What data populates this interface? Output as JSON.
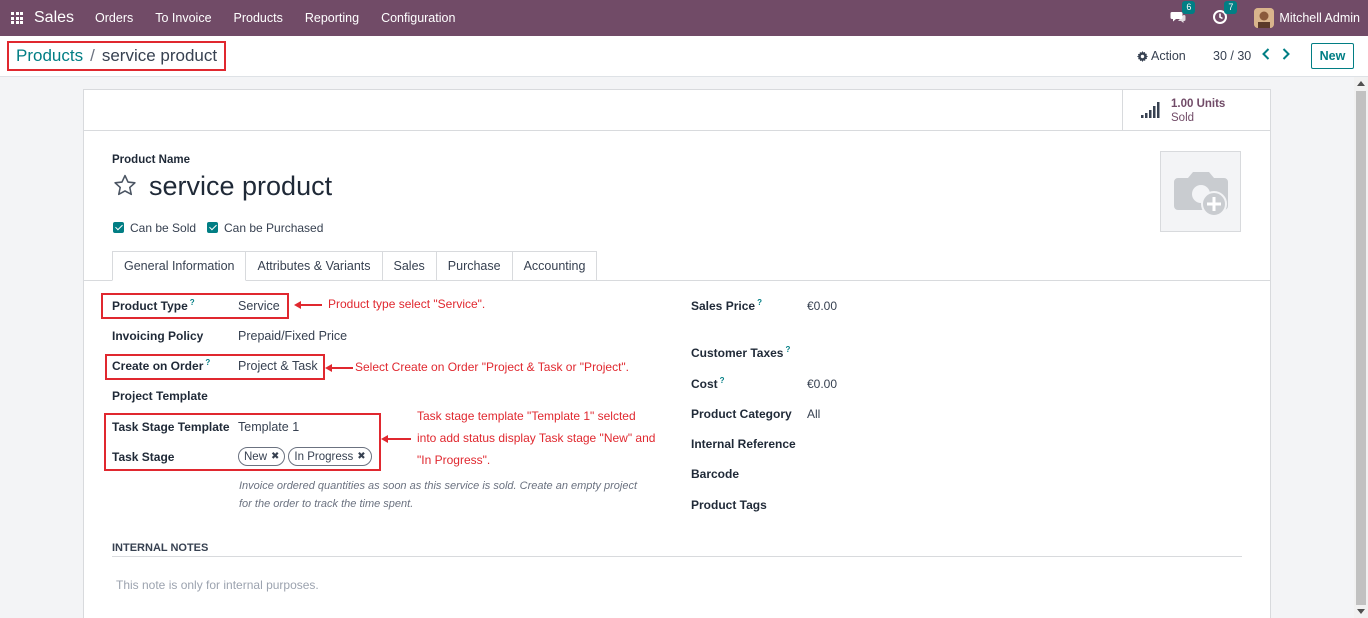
{
  "navbar": {
    "app_name": "Sales",
    "menu": [
      "Orders",
      "To Invoice",
      "Products",
      "Reporting",
      "Configuration"
    ],
    "messages_count": "6",
    "activities_count": "7",
    "user_name": "Mitchell Admin"
  },
  "breadcrumb": {
    "parent": "Products",
    "separator": "/",
    "current": "service product"
  },
  "control": {
    "action_label": "Action",
    "pager": "30 / 30",
    "new_label": "New"
  },
  "stat_button": {
    "value": "1.00 Units",
    "label": "Sold"
  },
  "product": {
    "name_label": "Product Name",
    "name": "service product",
    "can_be_sold_label": "Can be Sold",
    "can_be_purchased_label": "Can be Purchased"
  },
  "tabs": [
    "General Information",
    "Attributes & Variants",
    "Sales",
    "Purchase",
    "Accounting"
  ],
  "general": {
    "product_type_label": "Product Type",
    "product_type": "Service",
    "invoicing_policy_label": "Invoicing Policy",
    "invoicing_policy": "Prepaid/Fixed Price",
    "create_on_order_label": "Create on Order",
    "create_on_order": "Project & Task",
    "project_template_label": "Project Template",
    "task_stage_template_label": "Task Stage Template",
    "task_stage_template": "Template 1",
    "task_stage_label": "Task Stage",
    "task_stages": [
      "New",
      "In Progress"
    ],
    "help_text_1": "Invoice ordered quantities as soon as this service is sold. Create an empty project",
    "help_text_2": "for the order to track the time spent.",
    "sales_price_label": "Sales Price",
    "sales_price": "€0.00",
    "customer_taxes_label": "Customer Taxes",
    "cost_label": "Cost",
    "cost": "€0.00",
    "product_category_label": "Product Category",
    "product_category": "All",
    "internal_reference_label": "Internal Reference",
    "barcode_label": "Barcode",
    "product_tags_label": "Product Tags",
    "internal_notes_label": "INTERNAL NOTES",
    "internal_notes_placeholder": "This note is only for internal purposes."
  },
  "annotations": {
    "product_type": "Product type select \"Service\".",
    "create_on_order": "Select Create on Order \"Project & Task or \"Project\".",
    "task_stage_1": "Task stage template \"Template 1\" selcted",
    "task_stage_2": "into add status display Task stage \"New\" and",
    "task_stage_3": "\"In Progress\"."
  },
  "colors": {
    "navbar": "#714b67",
    "accent": "#017e84",
    "annotation": "#e0282f"
  }
}
